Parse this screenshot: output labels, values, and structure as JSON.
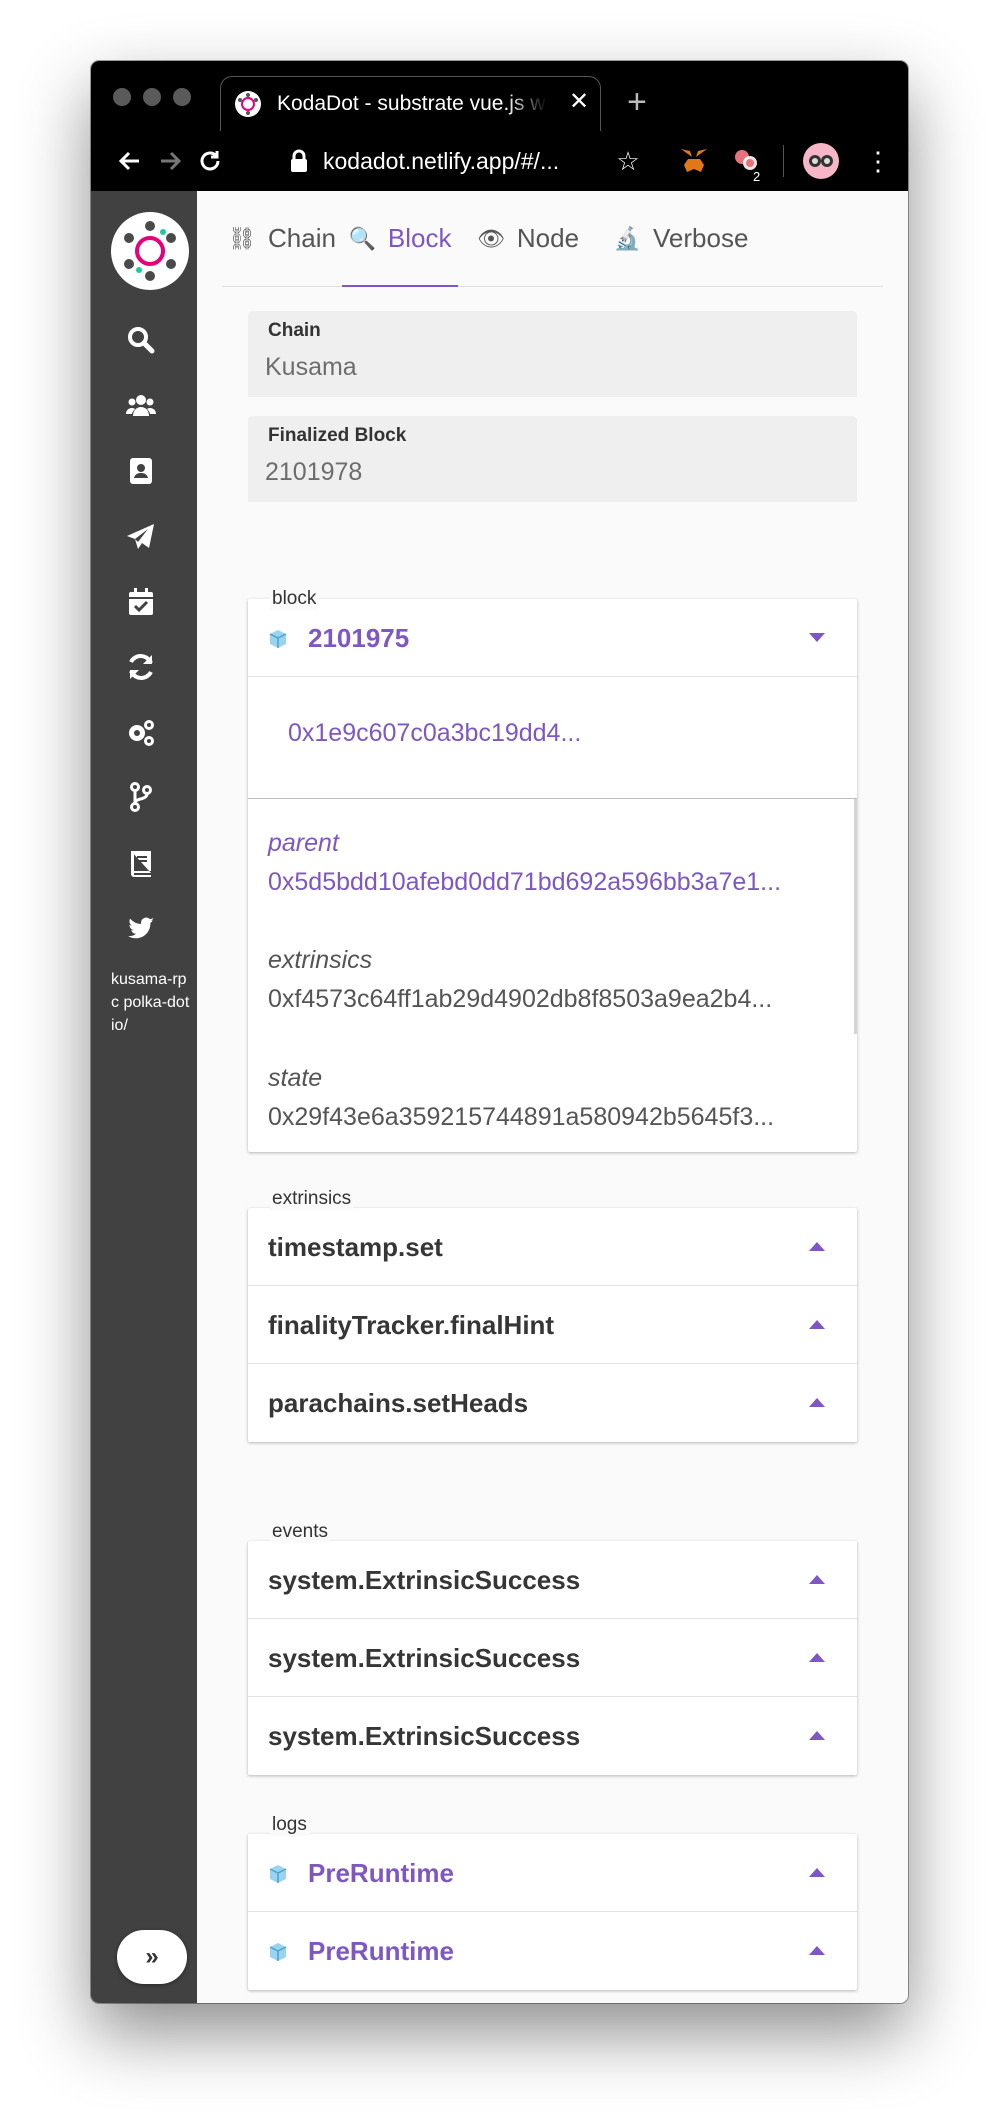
{
  "browser": {
    "tab_title": "KodaDot - substrate vue.js wallet",
    "url": "kodadot.netlify.app/#/...",
    "extension_badge": "2"
  },
  "sidebar": {
    "items": [
      {
        "icon": "search-icon"
      },
      {
        "icon": "users-icon"
      },
      {
        "icon": "address-book-icon"
      },
      {
        "icon": "paper-plane-icon"
      },
      {
        "icon": "calendar-check-icon"
      },
      {
        "icon": "sync-icon"
      },
      {
        "icon": "cogs-icon"
      },
      {
        "icon": "code-branch-icon"
      },
      {
        "icon": "book-icon"
      },
      {
        "icon": "twitter-icon"
      }
    ],
    "rpc_text": "kusama-rpc polka-dot io/",
    "collapse_label": "»"
  },
  "tabs": [
    {
      "label": "Chain",
      "icon": "chain-icon"
    },
    {
      "label": "Block",
      "icon": "magnifier-icon",
      "active": true
    },
    {
      "label": "Node",
      "icon": "eye-icon"
    },
    {
      "label": "Verbose",
      "icon": "microscope-icon"
    }
  ],
  "chain_field": {
    "label": "Chain",
    "value": "Kusama"
  },
  "finalized_field": {
    "label": "Finalized Block",
    "value": "2101978"
  },
  "block": {
    "section_label": "block",
    "number": "2101975",
    "hash": "0x1e9c607c0a3bc19dd4...",
    "parent_label": "parent",
    "parent_value": "0x5d5bdd10afebd0dd71bd692a596bb3a7e1...",
    "extrinsics_label": "extrinsics",
    "extrinsics_value": "0xf4573c64ff1ab29d4902db8f8503a9ea2b4...",
    "state_label": "state",
    "state_value": "0x29f43e6a359215744891a580942b5645f3..."
  },
  "extrinsics": {
    "section_label": "extrinsics",
    "items": [
      "timestamp.set",
      "finalityTracker.finalHint",
      "parachains.setHeads"
    ]
  },
  "events": {
    "section_label": "events",
    "items": [
      "system.ExtrinsicSuccess",
      "system.ExtrinsicSuccess",
      "system.ExtrinsicSuccess"
    ]
  },
  "logs": {
    "section_label": "logs",
    "items": [
      "PreRuntime",
      "PreRuntime"
    ]
  },
  "colors": {
    "accent": "#7e57c2",
    "sidebar": "#414141",
    "chrome": "#000000"
  }
}
